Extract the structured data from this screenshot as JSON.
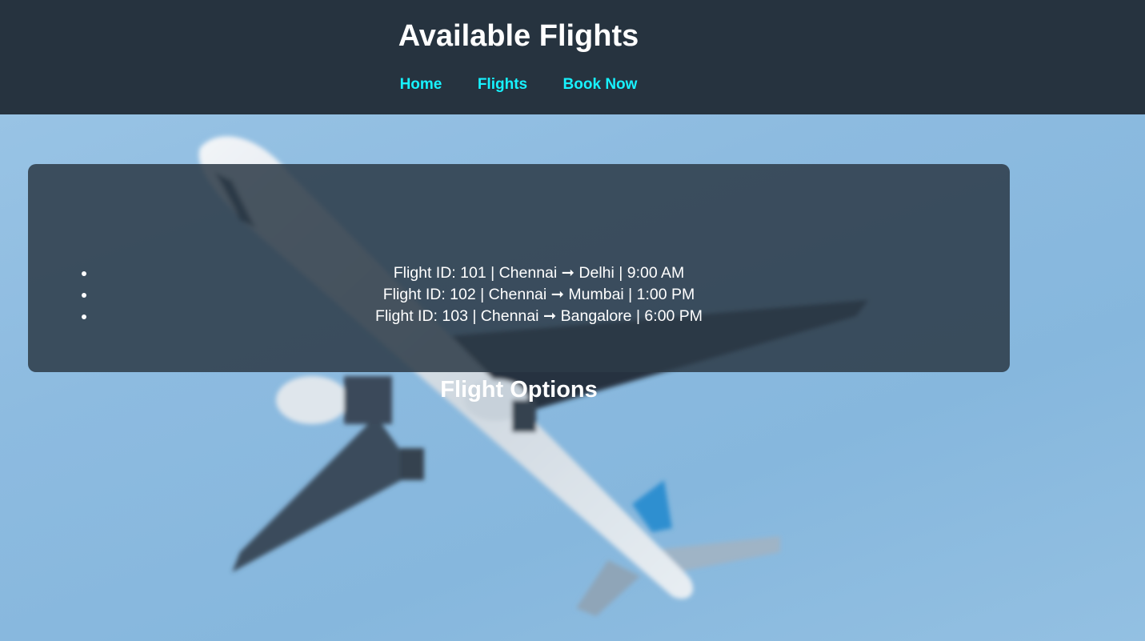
{
  "header": {
    "title": "Available Flights",
    "nav": [
      {
        "label": "Home"
      },
      {
        "label": "Flights"
      },
      {
        "label": "Book Now"
      }
    ]
  },
  "main": {
    "panel_title": "Flight Options",
    "flights": [
      {
        "text": "Flight ID: 101 | Chennai ➞ Delhi | 9:00 AM"
      },
      {
        "text": "Flight ID: 102 | Chennai ➞ Mumbai | 1:00 PM"
      },
      {
        "text": "Flight ID: 103 | Chennai ➞ Bangalore | 6:00 PM"
      }
    ]
  },
  "colors": {
    "header_bg": "#26333f",
    "nav_link": "#17f2ff",
    "panel_bg": "rgba(44,58,71,0.86)",
    "sky": "#8dbbe0"
  },
  "background": {
    "icon": "airplane-photo"
  }
}
